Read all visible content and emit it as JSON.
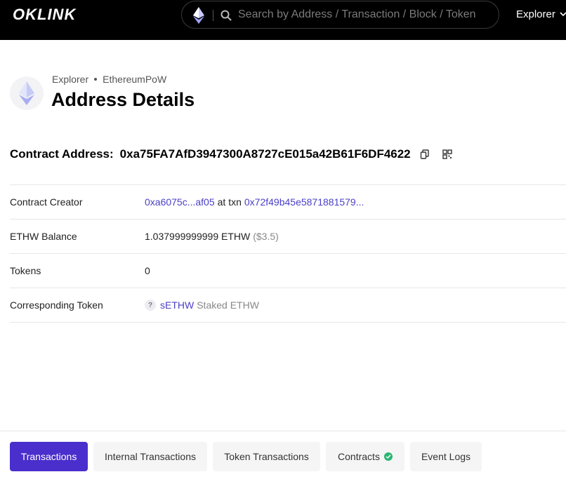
{
  "header": {
    "logo_text": "OKLINK",
    "search_placeholder": "Search by Address / Transaction / Block / Token",
    "explorer_label": "Explorer"
  },
  "breadcrumb": {
    "root": "Explorer",
    "chain": "EthereumPoW"
  },
  "page_title": "Address Details",
  "contract": {
    "label": "Contract Address:",
    "address": "0xa75FA7AfD3947300A8727cE015a42B61F6DF4622"
  },
  "details": {
    "creator": {
      "label": "Contract Creator",
      "creator_address": "0xa6075c...af05",
      "at_txn_text": "at txn",
      "txn_hash": "0x72f49b45e5871881579..."
    },
    "balance": {
      "label": "ETHW Balance",
      "amount": "1.037999999999 ETHW",
      "usd": "($3.5)"
    },
    "tokens": {
      "label": "Tokens",
      "count": "0"
    },
    "corresponding_token": {
      "label": "Corresponding Token",
      "icon_char": "?",
      "symbol": "sETHW",
      "name": "Staked ETHW"
    }
  },
  "tabs": [
    {
      "label": "Transactions",
      "active": true
    },
    {
      "label": "Internal Transactions",
      "active": false
    },
    {
      "label": "Token Transactions",
      "active": false
    },
    {
      "label": "Contracts",
      "active": false,
      "verified": true
    },
    {
      "label": "Event Logs",
      "active": false
    }
  ],
  "colors": {
    "accent": "#4a2fcc",
    "link": "#4a3fc7",
    "verified": "#2bb673",
    "header_bg": "#000000"
  }
}
